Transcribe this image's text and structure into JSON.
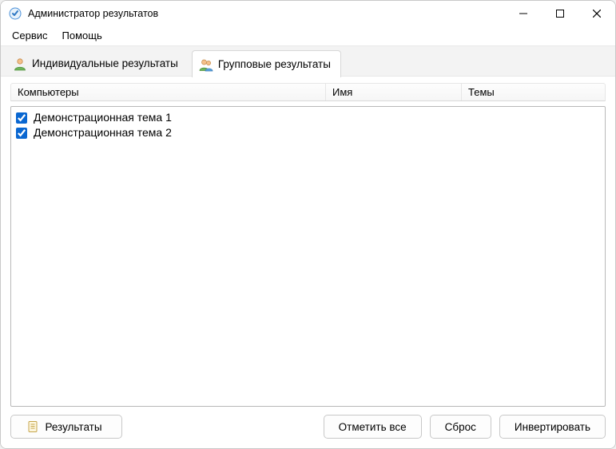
{
  "window": {
    "title": "Администратор результатов"
  },
  "menu": {
    "service": "Сервис",
    "help": "Помощь"
  },
  "tabs": {
    "individual": "Индивидуальные результаты",
    "group": "Групповые результаты",
    "active": "group"
  },
  "columns": {
    "computers": "Компьютеры",
    "name": "Имя",
    "themes": "Темы"
  },
  "items": [
    {
      "label": "Демонстрационная тема 1",
      "checked": true
    },
    {
      "label": "Демонстрационная тема 2",
      "checked": true
    }
  ],
  "buttons": {
    "results": "Результаты",
    "mark_all": "Отметить все",
    "reset": "Сброс",
    "invert": "Инвертировать"
  }
}
